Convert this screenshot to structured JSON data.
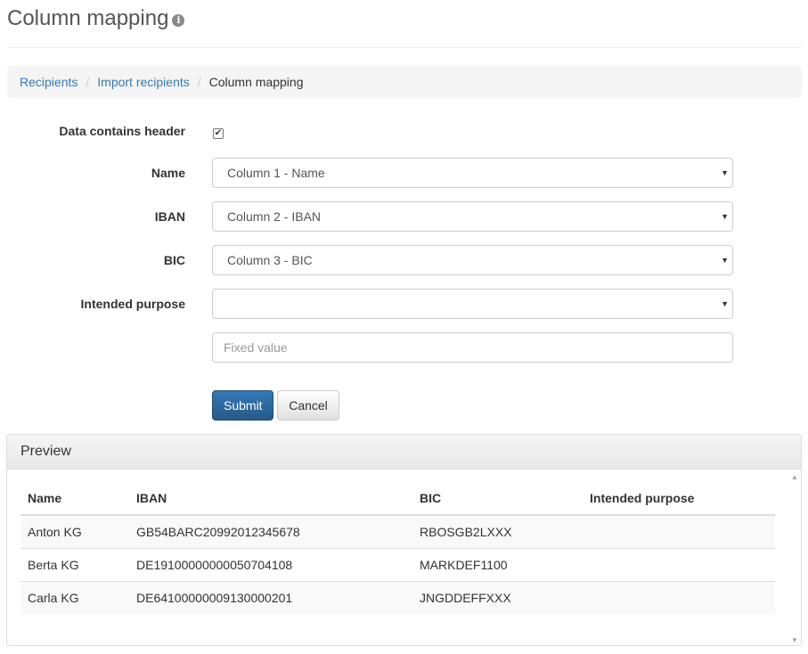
{
  "page": {
    "title": "Column mapping",
    "info_icon": "info-circle-icon"
  },
  "breadcrumb": {
    "items": [
      {
        "label": "Recipients"
      },
      {
        "label": "Import recipients"
      }
    ],
    "separator": "/",
    "active": "Column mapping"
  },
  "form": {
    "header_label": "Data contains header",
    "header_checked": true,
    "name": {
      "label": "Name",
      "value": "Column 1 - Name"
    },
    "iban": {
      "label": "IBAN",
      "value": "Column 2 - IBAN"
    },
    "bic": {
      "label": "BIC",
      "value": "Column 3 - BIC"
    },
    "purpose": {
      "label": "Intended purpose",
      "value": "",
      "fixed_placeholder": "Fixed value"
    },
    "submit_label": "Submit",
    "cancel_label": "Cancel"
  },
  "preview": {
    "title": "Preview",
    "columns": [
      "Name",
      "IBAN",
      "BIC",
      "Intended purpose"
    ],
    "rows": [
      [
        "Anton KG",
        "GB54BARC20992012345678",
        "RBOSGB2LXXX",
        ""
      ],
      [
        "Berta KG",
        "DE19100000000050704108",
        "MARKDEF1100",
        ""
      ],
      [
        "Carla KG",
        "DE64100000009130000201",
        "JNGDDEFFXXX",
        ""
      ]
    ]
  },
  "colors": {
    "link": "#337ab7",
    "primary": "#286090"
  }
}
